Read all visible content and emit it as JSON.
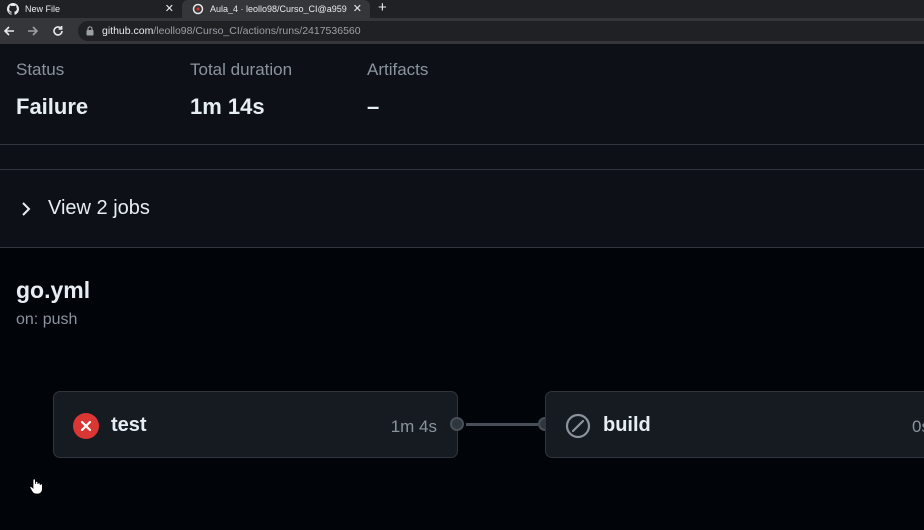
{
  "browser": {
    "tabs": [
      {
        "title": "New File",
        "icon": "github-icon",
        "active": false
      },
      {
        "title": "Aula_4 · leollo98/Curso_CI@a959",
        "icon": "github-icon",
        "active": true
      }
    ],
    "url_host": "github.com",
    "url_path": "/leollo98/Curso_CI/actions/runs/2417536560"
  },
  "summary": {
    "status_label": "Status",
    "status_value": "Failure",
    "duration_label": "Total duration",
    "duration_value": "1m 14s",
    "artifacts_label": "Artifacts",
    "artifacts_value": "–"
  },
  "jobs_toggle": {
    "label": "View 2 jobs"
  },
  "workflow": {
    "title": "go.yml",
    "trigger": "on: push",
    "jobs": [
      {
        "name": "test",
        "duration": "1m 4s",
        "status": "failure",
        "icon": "x-circle-icon"
      },
      {
        "name": "build",
        "duration": "0s",
        "status": "skipped",
        "icon": "skip-icon"
      }
    ]
  },
  "colors": {
    "background": "#010409",
    "panel": "#0d1117",
    "card": "#161b22",
    "failure": "#da3633",
    "muted": "#8b949e"
  }
}
